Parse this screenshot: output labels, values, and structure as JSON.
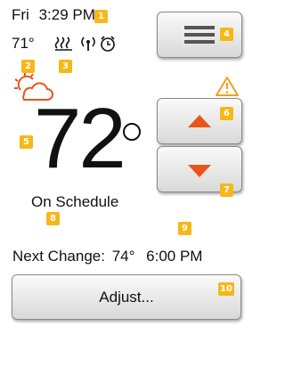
{
  "header": {
    "day": "Fri",
    "time": "3:29 PM",
    "indoor_temp": "71°"
  },
  "icons": {
    "heating": "heating-coil-icon",
    "wireless": "wireless-signal-icon",
    "alarm": "alarm-clock-icon",
    "weather": "partly-cloudy-icon",
    "warning": "warning-triangle-icon",
    "menu": "menu-icon",
    "up": "arrow-up-icon",
    "down": "arrow-down-icon"
  },
  "main": {
    "setpoint": "72",
    "status": "On Schedule",
    "next_change_label": "Next Change:",
    "next_change_temp": "74°",
    "next_change_time": "6:00 PM"
  },
  "buttons": {
    "adjust_label": "Adjust..."
  },
  "markers": [
    "1",
    "2",
    "3",
    "4",
    "5",
    "6",
    "7",
    "8",
    "9",
    "10"
  ],
  "colors": {
    "accent_orange": "#e8551c",
    "warning_orange": "#f0a020",
    "marker_yellow": "#f6b817"
  }
}
